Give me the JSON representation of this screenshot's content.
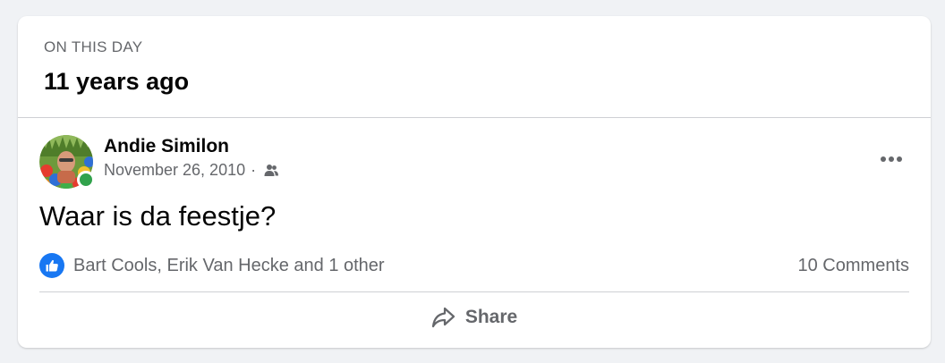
{
  "memory": {
    "eyebrow": "ON THIS DAY",
    "years_ago": "11 years ago"
  },
  "post": {
    "author": "Andie Similon",
    "date": "November 26, 2010",
    "separator": "·",
    "audience_icon": "friends-icon",
    "online": true,
    "text": "Waar is da feestje?",
    "reactions": {
      "icon": "like-icon",
      "summary": "Bart Cools, Erik Van Hecke and 1 other"
    },
    "comments": "10 Comments",
    "actions": {
      "share_label": "Share",
      "share_icon": "share-arrow-icon",
      "more_icon": "more-options-icon"
    }
  },
  "colors": {
    "background": "#f0f2f5",
    "card": "#ffffff",
    "primary_text": "#050505",
    "secondary_text": "#65676b",
    "like_blue": "#1877f2",
    "online_green": "#31a24c",
    "divider": "#ced0d4"
  }
}
